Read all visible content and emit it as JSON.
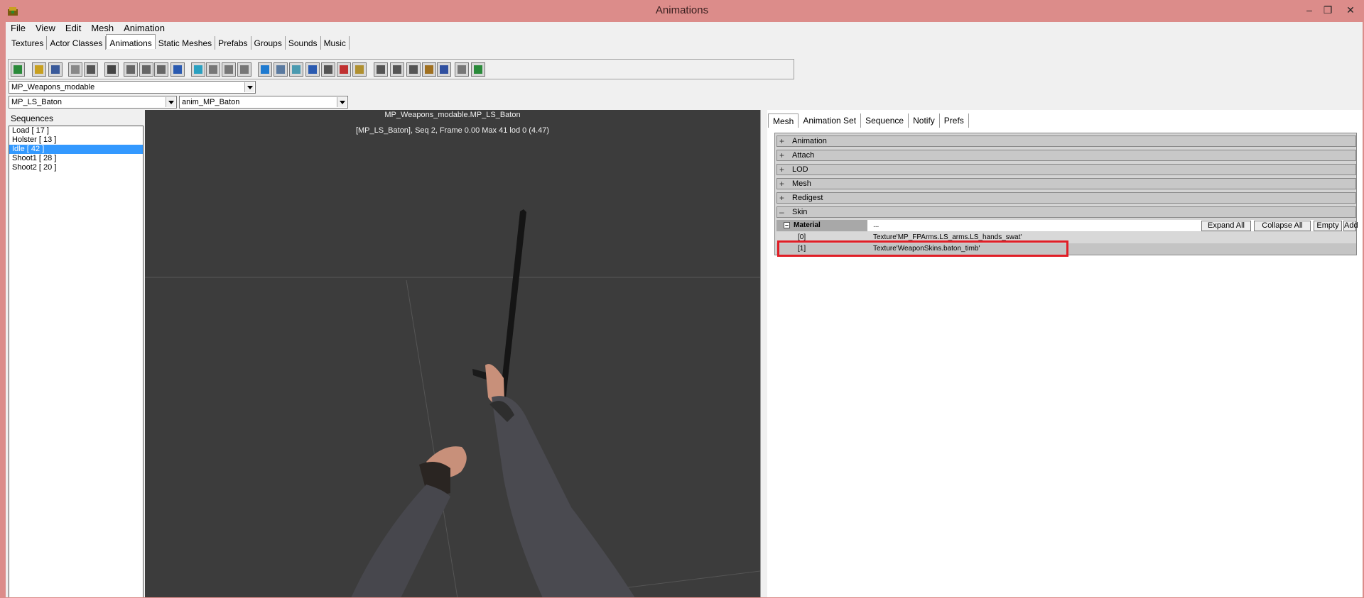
{
  "window": {
    "title": "Animations",
    "minimize": "–",
    "restore": "❐",
    "close": "✕"
  },
  "menu": [
    "File",
    "View",
    "Edit",
    "Mesh",
    "Animation"
  ],
  "browser_tabs": [
    "Textures",
    "Actor Classes",
    "Animations",
    "Static Meshes",
    "Prefabs",
    "Groups",
    "Sounds",
    "Music"
  ],
  "toolbar_icons": [
    "import-icon",
    "open-icon",
    "save-icon",
    "copy-icon",
    "find-icon",
    "bake-icon",
    "mesh-prop-1-icon",
    "mesh-prop-2-icon",
    "mesh-prop-3-icon",
    "link-icon",
    "pivot-icon",
    "mesh-a-icon",
    "mesh-b-icon",
    "mesh-c-icon",
    "cylinder-icon",
    "wire-icon",
    "grid-icon",
    "skeleton-icon",
    "normals-icon",
    "bone-icon",
    "bounds-icon",
    "lod-1-icon",
    "lod-2-icon",
    "lod-3-icon",
    "lod-4-icon",
    "lod-5-icon",
    "clone-icon",
    "export-icon"
  ],
  "package_combo": "MP_Weapons_modable",
  "mesh_combo": "MP_LS_Baton",
  "anim_combo": "anim_MP_Baton",
  "sequences": {
    "label": "Sequences",
    "items": [
      "Load [ 17 ]",
      "Holster [ 13 ]",
      "Idle [ 42 ]",
      "Shoot1 [ 28 ]",
      "Shoot2 [ 20 ]"
    ],
    "selected": 2
  },
  "viewport": {
    "title": "MP_Weapons_modable.MP_LS_Baton",
    "status": "[MP_LS_Baton], Seq 2,  Frame  0.00 Max 41  lod 0 (4.47)"
  },
  "right_tabs": [
    "Mesh",
    "Animation Set",
    "Sequence",
    "Notify",
    "Prefs"
  ],
  "properties": {
    "categories": [
      "Animation",
      "Attach",
      "LOD",
      "Mesh",
      "Redigest",
      "Skin"
    ],
    "material_label": "Material",
    "material_value": "...",
    "buttons": [
      "Expand All",
      "Collapse All",
      "Empty",
      "Add"
    ],
    "rows": [
      {
        "key": "[0]",
        "value": "Texture'MP_FPArms.LS_arms.LS_hands_swat'"
      },
      {
        "key": "[1]",
        "value": "Texture'WeaponSkins.baton_timb'"
      }
    ]
  },
  "colors": {
    "titlebar": "#dc8c8a",
    "selection": "#3399ff",
    "highlight": "#e01e26",
    "viewport": "#3c3c3c"
  }
}
